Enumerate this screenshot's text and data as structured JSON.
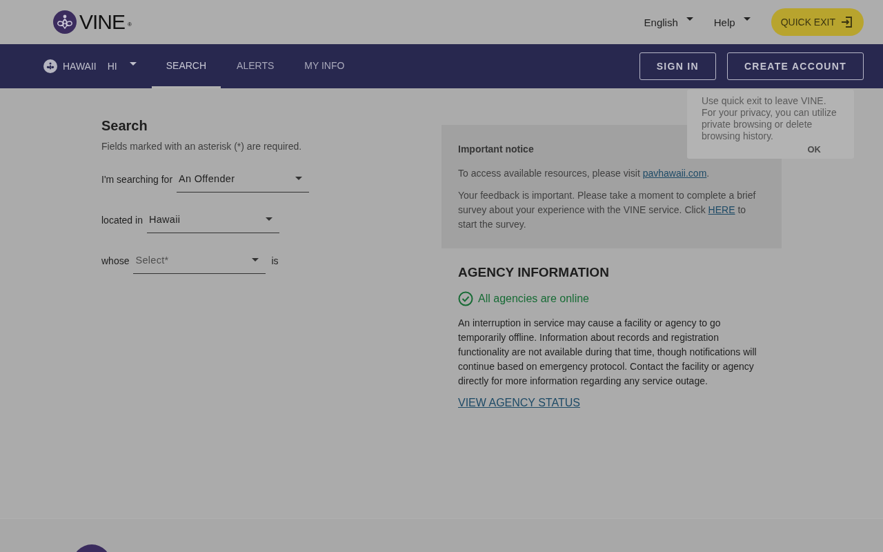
{
  "header": {
    "logo_text": "VINE",
    "logo_mark": "®",
    "language": "English",
    "help": "Help",
    "quick_exit": "QUICK EXIT"
  },
  "nav": {
    "state": "HAWAII",
    "state_code": "HI",
    "tabs": [
      {
        "label": "SEARCH",
        "selected": true
      },
      {
        "label": "ALERTS",
        "selected": false
      },
      {
        "label": "MY INFO",
        "selected": false
      }
    ],
    "buttons": [
      "SIGN IN",
      "CREATE ACCOUNT"
    ]
  },
  "popover": {
    "text": "Use quick exit to leave VINE.  For your privacy, you can utilize private browsing or delete browsing history.",
    "button": "OK"
  },
  "search": {
    "title": "Search",
    "note": "Fields marked with an asterisk (*) are required.",
    "fields": [
      {
        "label": "I'm searching for",
        "value": "An Offender"
      },
      {
        "label": "located in",
        "value": "Hawaii"
      },
      {
        "label": "whose",
        "placeholder": "Select*",
        "suffix": "is"
      }
    ]
  },
  "notice": {
    "title": "Important notice",
    "paragraphs": [
      {
        "before": "To access available resources, please visit ",
        "link": "pavhawaii.com",
        "after": "."
      },
      {
        "before": "Your feedback is important. Please take a moment to complete a brief survey about your experience with the VINE service. Click ",
        "link": "HERE",
        "after": " to start the survey."
      }
    ]
  },
  "agency": {
    "title": "AGENCY INFORMATION",
    "online": true,
    "status": "All agencies are online",
    "body": "An interruption in service may cause a facility or agency to go temporarily offline. Information about records and registration functionality are not available during that time, though notifications will continue based on emergency protocol. Contact the facility or agency directly for more information regarding any service outage.",
    "link": "VIEW AGENCY STATUS"
  }
}
